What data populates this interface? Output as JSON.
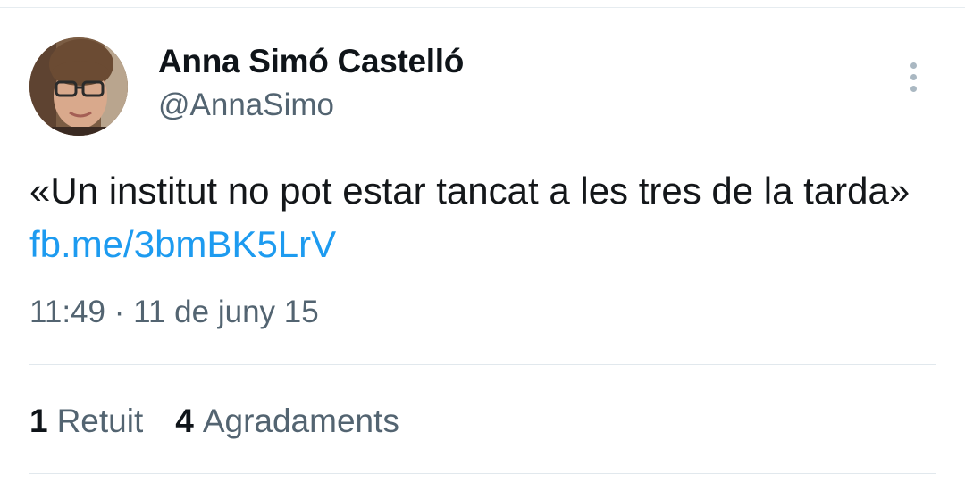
{
  "author": {
    "display_name": "Anna Simó Castelló",
    "handle": "@AnnaSimo"
  },
  "tweet": {
    "text": "«Un institut no pot estar tancat a les tres de la tarda»",
    "link": "fb.me/3bmBK5LrV",
    "time": "11:49",
    "separator": "·",
    "date": "11 de juny 15"
  },
  "stats": {
    "retweets_count": "1",
    "retweets_label": "Retuit",
    "likes_count": "4",
    "likes_label": "Agradaments"
  },
  "icons": {
    "more": "more-vertical-icon"
  },
  "colors": {
    "link": "#1d9bf0",
    "secondary_text": "#536471",
    "primary_text": "#0f1419"
  }
}
